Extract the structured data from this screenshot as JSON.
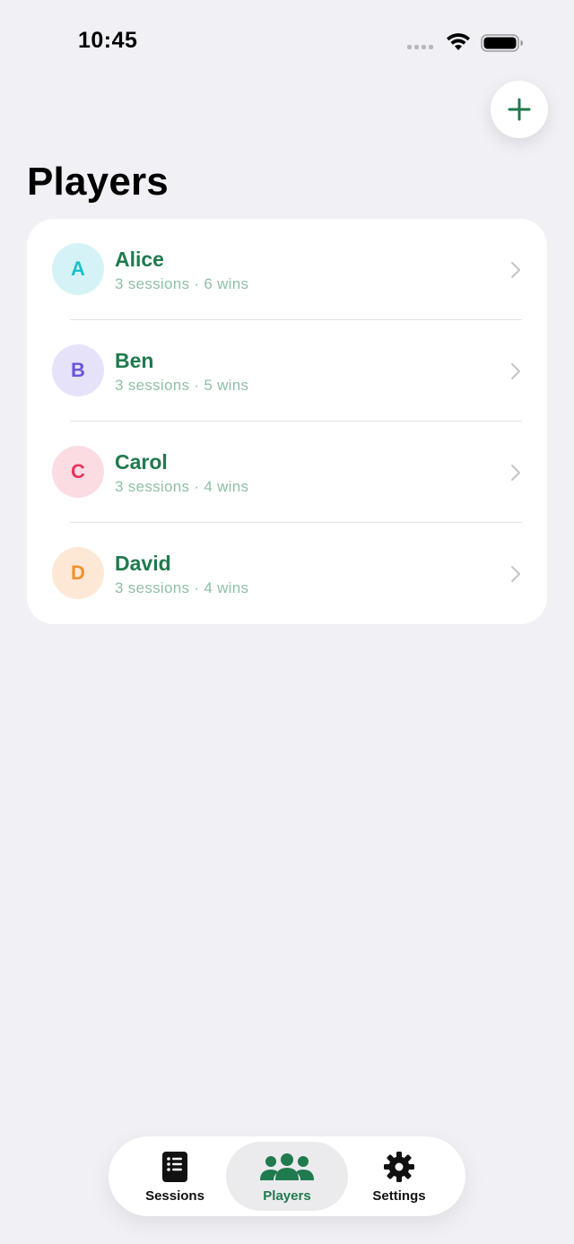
{
  "status_bar": {
    "time": "10:45"
  },
  "header": {
    "title": "Players",
    "add_icon": "plus-icon"
  },
  "colors": {
    "accent": "#1F7A4D",
    "secondary_text": "#8FBFA6",
    "background": "#F0F0F5"
  },
  "players": [
    {
      "initial": "A",
      "name": "Alice",
      "meta": "3 sessions · 6 wins",
      "avatar_bg": "#D5F3F7",
      "avatar_fg": "#1BC0C9"
    },
    {
      "initial": "B",
      "name": "Ben",
      "meta": "3 sessions · 5 wins",
      "avatar_bg": "#E5E2FA",
      "avatar_fg": "#6C55D8"
    },
    {
      "initial": "C",
      "name": "Carol",
      "meta": "3 sessions · 4 wins",
      "avatar_bg": "#FCDCE3",
      "avatar_fg": "#E7355E"
    },
    {
      "initial": "D",
      "name": "David",
      "meta": "3 sessions · 4 wins",
      "avatar_bg": "#FDE8D6",
      "avatar_fg": "#F0922D"
    }
  ],
  "tabbar": {
    "tabs": [
      {
        "label": "Sessions",
        "icon": "list-book-icon",
        "active": false
      },
      {
        "label": "Players",
        "icon": "people-icon",
        "active": true
      },
      {
        "label": "Settings",
        "icon": "gear-icon",
        "active": false
      }
    ]
  }
}
